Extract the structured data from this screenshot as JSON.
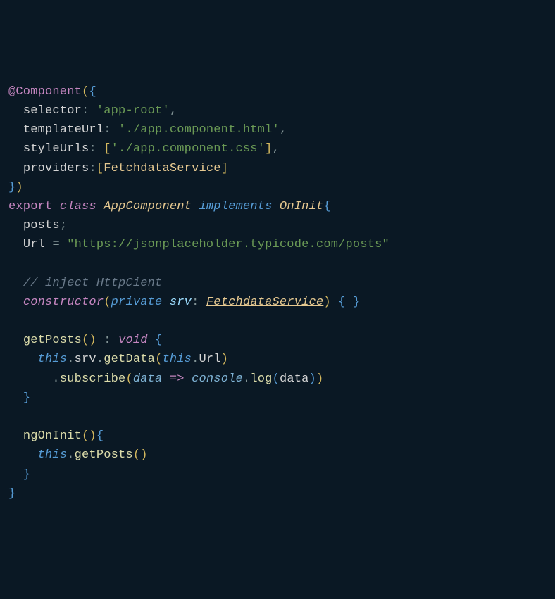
{
  "code": {
    "decorator": "@Component",
    "selector_key": "selector",
    "selector_val": "'app-root'",
    "templateUrl_key": "templateUrl",
    "templateUrl_val": "'./app.component.html'",
    "styleUrls_key": "styleUrls",
    "styleUrls_val": "'./app.component.css'",
    "providers_key": "providers",
    "providers_val": "FetchdataService",
    "export": "export",
    "class": "class",
    "className": "AppComponent",
    "implements": "implements",
    "interface": "OnInit",
    "posts": "posts",
    "url_key": "Url",
    "url_q1": "\"",
    "url_val": "https://jsonplaceholder.typicode.com/posts",
    "url_q2": "\"",
    "comment": "// inject HttpCient",
    "constructor": "constructor",
    "private": "private",
    "srv": "srv",
    "serviceType": "FetchdataService",
    "getPosts": "getPosts",
    "void": "void",
    "this1": "this",
    "srv1": "srv",
    "getData": "getData",
    "url1": "Url",
    "subscribe": "subscribe",
    "data": "data",
    "console": "console",
    "log": "log",
    "data2": "data",
    "ngOnInit": "ngOnInit",
    "this2": "this",
    "getPosts2": "getPosts",
    "this3": "this"
  }
}
